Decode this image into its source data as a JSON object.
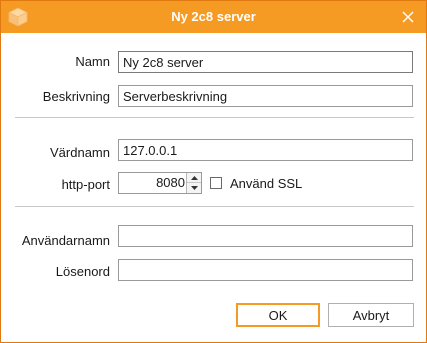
{
  "window": {
    "title": "Ny 2c8 server",
    "accent_color": "#f59a23",
    "app_icon": "cube-icon",
    "close_icon": "close-icon"
  },
  "form": {
    "name": {
      "label": "Namn",
      "value": "Ny 2c8 server"
    },
    "description": {
      "label": "Beskrivning",
      "value": "Serverbeskrivning"
    },
    "hostname": {
      "label": "Värdnamn",
      "value": "127.0.0.1"
    },
    "http_port": {
      "label": "http-port",
      "value": "8080"
    },
    "use_ssl": {
      "label": "Använd SSL",
      "checked": false
    },
    "username": {
      "label": "Användarnamn",
      "value": ""
    },
    "password": {
      "label": "Lösenord",
      "value": ""
    }
  },
  "buttons": {
    "ok": "OK",
    "cancel": "Avbryt"
  }
}
